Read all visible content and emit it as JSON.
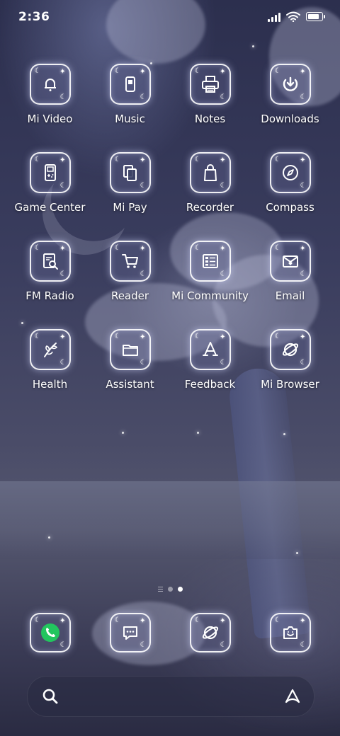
{
  "status_bar": {
    "time": "2:36"
  },
  "apps": [
    {
      "label": "Mi Video",
      "icon": "bell-icon"
    },
    {
      "label": "Music",
      "icon": "music-player-icon"
    },
    {
      "label": "Notes",
      "icon": "printer-icon"
    },
    {
      "label": "Downloads",
      "icon": "download-icon"
    },
    {
      "label": "Game Center",
      "icon": "gameboy-icon"
    },
    {
      "label": "Mi Pay",
      "icon": "cards-icon"
    },
    {
      "label": "Recorder",
      "icon": "bag-icon"
    },
    {
      "label": "Compass",
      "icon": "compass-icon"
    },
    {
      "label": "FM Radio",
      "icon": "document-search-icon"
    },
    {
      "label": "Reader",
      "icon": "cart-icon"
    },
    {
      "label": "Mi Community",
      "icon": "list-icon"
    },
    {
      "label": "Email",
      "icon": "envelope-heart-icon"
    },
    {
      "label": "Health",
      "icon": "leaf-icon"
    },
    {
      "label": "Assistant",
      "icon": "folder-icon"
    },
    {
      "label": "Feedback",
      "icon": "app-store-icon"
    },
    {
      "label": "Mi Browser",
      "icon": "planet-icon"
    }
  ],
  "dock": [
    {
      "name": "phone",
      "icon": "phone-icon"
    },
    {
      "name": "messages",
      "icon": "chat-bubble-icon"
    },
    {
      "name": "browser",
      "icon": "planet-icon"
    },
    {
      "name": "camera",
      "icon": "camera-icon"
    }
  ],
  "pager": {
    "pages": 2,
    "active": 2
  },
  "colors": {
    "phone_accent": "#22c55e",
    "glow": "#dfe3ff"
  }
}
